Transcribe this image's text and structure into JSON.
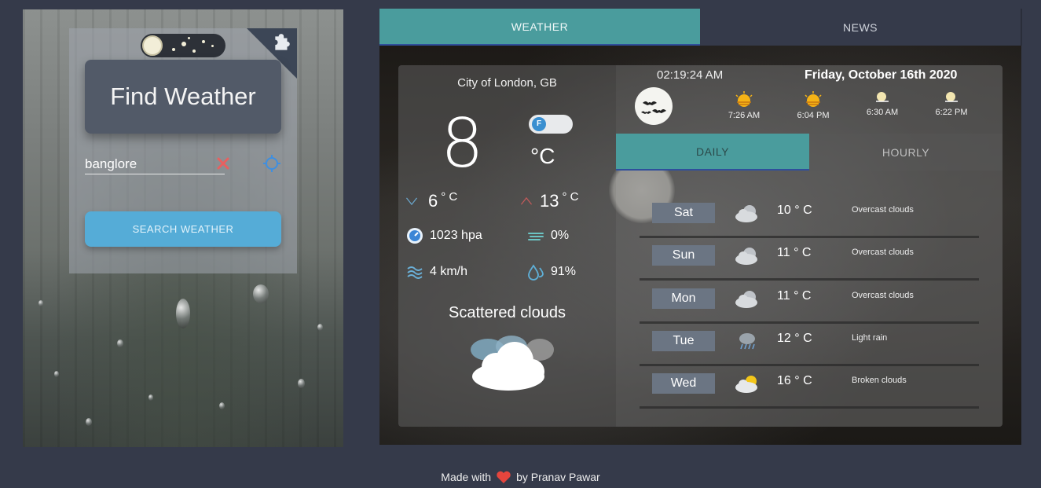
{
  "search_panel": {
    "title": "Find Weather",
    "city_input_value": "banglore",
    "search_button_label": "SEARCH WEATHER"
  },
  "tabs": {
    "weather": "WEATHER",
    "news": "NEWS"
  },
  "current": {
    "city": "City of London, GB",
    "temperature": "8",
    "unit": "°C",
    "unit_toggle_label": "F",
    "min_temp": "6",
    "max_temp": "13",
    "deg_unit": "° C",
    "pressure": "1023 hpa",
    "cloudiness": "0%",
    "wind": "4 km/h",
    "humidity": "91%",
    "description": "Scattered clouds"
  },
  "header": {
    "time": "02:19:24 AM",
    "date": "Friday, October 16th 2020",
    "sunrise": "7:26 AM",
    "sunset": "6:04 PM",
    "moonrise": "6:30 AM",
    "moonset": "6:22 PM"
  },
  "forecast_tabs": {
    "daily": "DAILY",
    "hourly": "HOURLY"
  },
  "daily": [
    {
      "day": "Sat",
      "temp": "10",
      "unit": "° C",
      "desc": "Overcast clouds",
      "icon": "overcast-clouds-icon"
    },
    {
      "day": "Sun",
      "temp": "11",
      "unit": "° C",
      "desc": "Overcast clouds",
      "icon": "overcast-clouds-icon"
    },
    {
      "day": "Mon",
      "temp": "11",
      "unit": "° C",
      "desc": "Overcast clouds",
      "icon": "overcast-clouds-icon"
    },
    {
      "day": "Tue",
      "temp": "12",
      "unit": "° C",
      "desc": "Light rain",
      "icon": "light-rain-icon"
    },
    {
      "day": "Wed",
      "temp": "16",
      "unit": "° C",
      "desc": "Broken clouds",
      "icon": "broken-clouds-icon"
    }
  ],
  "footer": {
    "made_with": "Made with",
    "by": "by Pranav Pawar"
  },
  "colors": {
    "accent_teal": "#4a9c9d",
    "button_blue": "#55acd7",
    "page_bg": "#353a4a",
    "heart": "#e5453d"
  }
}
